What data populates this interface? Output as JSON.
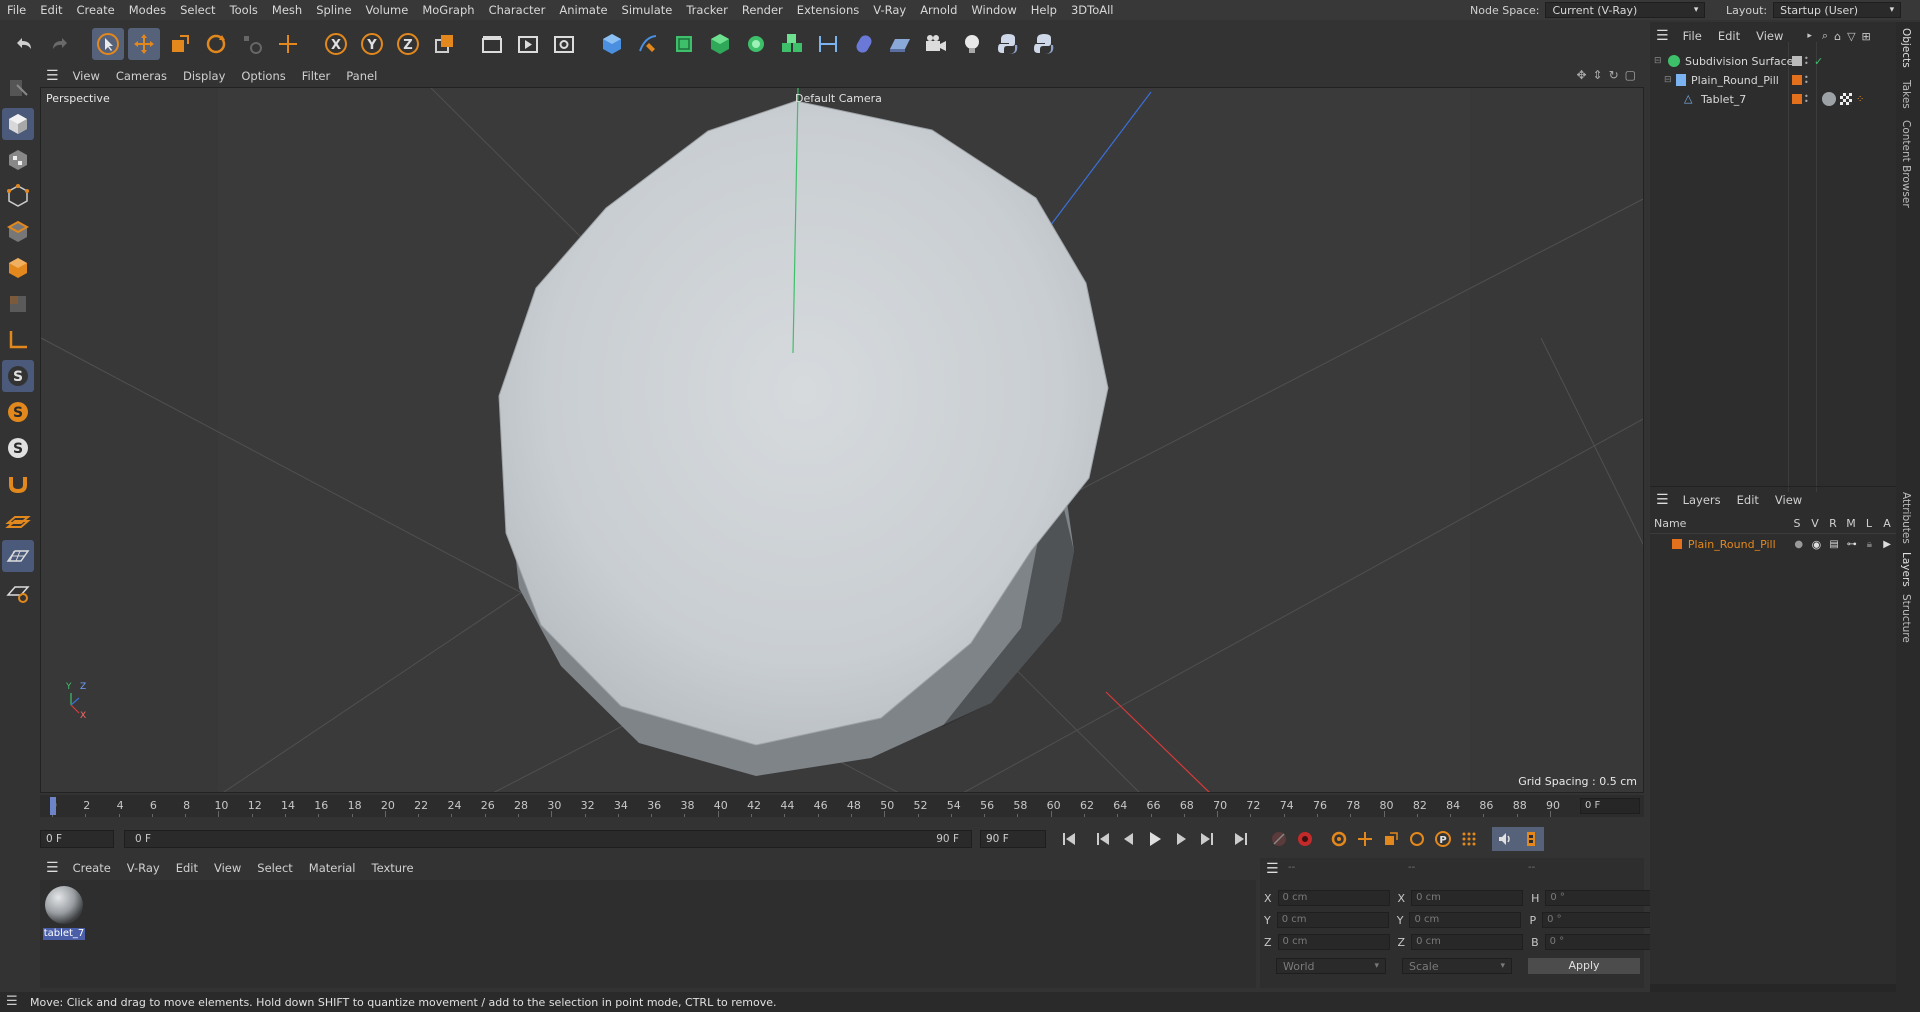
{
  "menubar": {
    "items": [
      "File",
      "Edit",
      "Create",
      "Modes",
      "Select",
      "Tools",
      "Mesh",
      "Spline",
      "Volume",
      "MoGraph",
      "Character",
      "Animate",
      "Simulate",
      "Tracker",
      "Render",
      "Extensions",
      "V-Ray",
      "Arnold",
      "Window",
      "Help",
      "3DToAll"
    ],
    "node_space_label": "Node Space:",
    "node_space_value": "Current (V-Ray)",
    "layout_label": "Layout:",
    "layout_value": "Startup (User)"
  },
  "viewport": {
    "menu": [
      "View",
      "Cameras",
      "Display",
      "Options",
      "Filter",
      "Panel"
    ],
    "label": "Perspective",
    "camera": "Default Camera",
    "grid_spacing": "Grid Spacing : 0.5 cm",
    "axis_labels": {
      "y": "Y",
      "z": "Z",
      "x": "X"
    }
  },
  "timeline": {
    "ticks": [
      "0",
      "2",
      "4",
      "6",
      "8",
      "10",
      "12",
      "14",
      "16",
      "18",
      "20",
      "22",
      "24",
      "26",
      "28",
      "30",
      "32",
      "34",
      "36",
      "38",
      "40",
      "42",
      "44",
      "46",
      "48",
      "50",
      "52",
      "54",
      "56",
      "58",
      "60",
      "62",
      "64",
      "66",
      "68",
      "70",
      "72",
      "74",
      "76",
      "78",
      "80",
      "82",
      "84",
      "86",
      "88",
      "90"
    ],
    "current_frame": "0 F",
    "start_field": "0 F",
    "range_start": "0 F",
    "range_end": "90 F",
    "end_field": "90 F"
  },
  "material_manager": {
    "menu": [
      "Create",
      "V-Ray",
      "Edit",
      "View",
      "Select",
      "Material",
      "Texture"
    ],
    "materials": [
      {
        "name": "tablet_7"
      }
    ]
  },
  "coordinates": {
    "headers": [
      "--",
      "--",
      "--"
    ],
    "rows": [
      {
        "a": "X",
        "av": "0 cm",
        "b": "X",
        "bv": "0 cm",
        "c": "H",
        "cv": "0 °"
      },
      {
        "a": "Y",
        "av": "0 cm",
        "b": "Y",
        "bv": "0 cm",
        "c": "P",
        "cv": "0 °"
      },
      {
        "a": "Z",
        "av": "0 cm",
        "b": "Z",
        "bv": "0 cm",
        "c": "B",
        "cv": "0 °"
      }
    ],
    "mode": "World",
    "type": "Scale",
    "apply": "Apply"
  },
  "objects_panel": {
    "menu": [
      "File",
      "Edit",
      "View"
    ],
    "objects": [
      {
        "name": "Subdivision Surface"
      },
      {
        "name": "Plain_Round_Pill"
      },
      {
        "name": "Tablet_7"
      }
    ]
  },
  "layers_panel": {
    "menu": [
      "Layers",
      "Edit",
      "View"
    ],
    "columns": [
      "Name",
      "S",
      "V",
      "R",
      "M",
      "L",
      "A"
    ],
    "layers": [
      {
        "name": "Plain_Round_Pill",
        "color": "#e2701c"
      }
    ]
  },
  "right_tabs": [
    "Objects",
    "Takes",
    "Content Browser",
    "Attributes",
    "Layers",
    "Structure"
  ],
  "status": {
    "text": "Move: Click and drag to move elements. Hold down SHIFT to quantize movement / add to the selection in point mode, CTRL to remove."
  },
  "colors": {
    "accent": "#e2881c",
    "selection": "#4a5fa8",
    "highlight": "#56627a"
  }
}
